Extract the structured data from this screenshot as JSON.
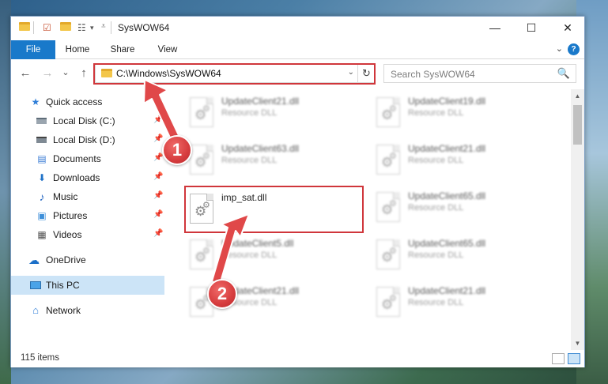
{
  "window": {
    "title": "SysWOW64",
    "minimize_glyph": "—",
    "maximize_glyph": "☐",
    "close_glyph": "✕"
  },
  "ribbon": {
    "tabs": [
      "File",
      "Home",
      "Share",
      "View"
    ],
    "help_glyph": "?"
  },
  "nav": {
    "back_glyph": "←",
    "forward_glyph": "→",
    "recent_glyph": "⌄",
    "up_glyph": "↑"
  },
  "address": {
    "path": "C:\\Windows\\SysWOW64",
    "dropdown_glyph": "⌄",
    "refresh_glyph": "↻"
  },
  "search": {
    "placeholder": "Search SysWOW64",
    "icon": "🔍"
  },
  "sidebar": {
    "items": [
      {
        "label": "Quick access",
        "icon": "star-icon",
        "glyph": "★",
        "color": "#2f7ed8",
        "pinned": false
      },
      {
        "label": "Local Disk (C:)",
        "icon": "drive-c-icon",
        "glyph": "",
        "color": "#5f6d79",
        "pinned": true
      },
      {
        "label": "Local Disk (D:)",
        "icon": "drive-d-icon",
        "glyph": "",
        "color": "#444444",
        "pinned": true
      },
      {
        "label": "Documents",
        "icon": "documents-icon",
        "glyph": "▤",
        "color": "#3a7bd5",
        "pinned": true
      },
      {
        "label": "Downloads",
        "icon": "downloads-icon",
        "glyph": "⬇",
        "color": "#1f72c8",
        "pinned": true
      },
      {
        "label": "Music",
        "icon": "music-icon",
        "glyph": "♪",
        "color": "#2b6cc4",
        "pinned": true
      },
      {
        "label": "Pictures",
        "icon": "pictures-icon",
        "glyph": "▣",
        "color": "#3d8fd9",
        "pinned": true
      },
      {
        "label": "Videos",
        "icon": "videos-icon",
        "glyph": "▦",
        "color": "#555555",
        "pinned": true
      },
      {
        "label": "OneDrive",
        "icon": "onedrive-icon",
        "glyph": "☁",
        "color": "#1b6fc8",
        "pinned": false
      },
      {
        "label": "This PC",
        "icon": "this-pc-icon",
        "glyph": "",
        "color": "#4aa3e8",
        "pinned": false
      },
      {
        "label": "Network",
        "icon": "network-icon",
        "glyph": "⌂",
        "color": "#2f7ed8",
        "pinned": false
      }
    ],
    "pin_glyph": "📌"
  },
  "files": [
    {
      "name": "UpdateClient21.dll",
      "type": "Resource DLL"
    },
    {
      "name": "UpdateClient19.dll",
      "type": "Resource DLL"
    },
    {
      "name": "UpdateClient63.dll",
      "type": "Resource DLL"
    },
    {
      "name": "UpdateClient21.dll",
      "type": "Resource DLL"
    },
    {
      "name": "imp_sat.dll",
      "type": ""
    },
    {
      "name": "UpdateClient65.dll",
      "type": "Resource DLL"
    },
    {
      "name": "UpdateClient5.dll",
      "type": "Resource DLL"
    },
    {
      "name": "UpdateClient65.dll",
      "type": "Resource DLL"
    },
    {
      "name": "UpdateClient21.dll",
      "type": "Resource DLL"
    },
    {
      "name": "UpdateClient21.dll",
      "type": "Resource DLL"
    }
  ],
  "status": {
    "item_count": "115 items"
  },
  "annotations": {
    "badge_1": "1",
    "badge_2": "2",
    "highlight_color": "#d0363b"
  }
}
